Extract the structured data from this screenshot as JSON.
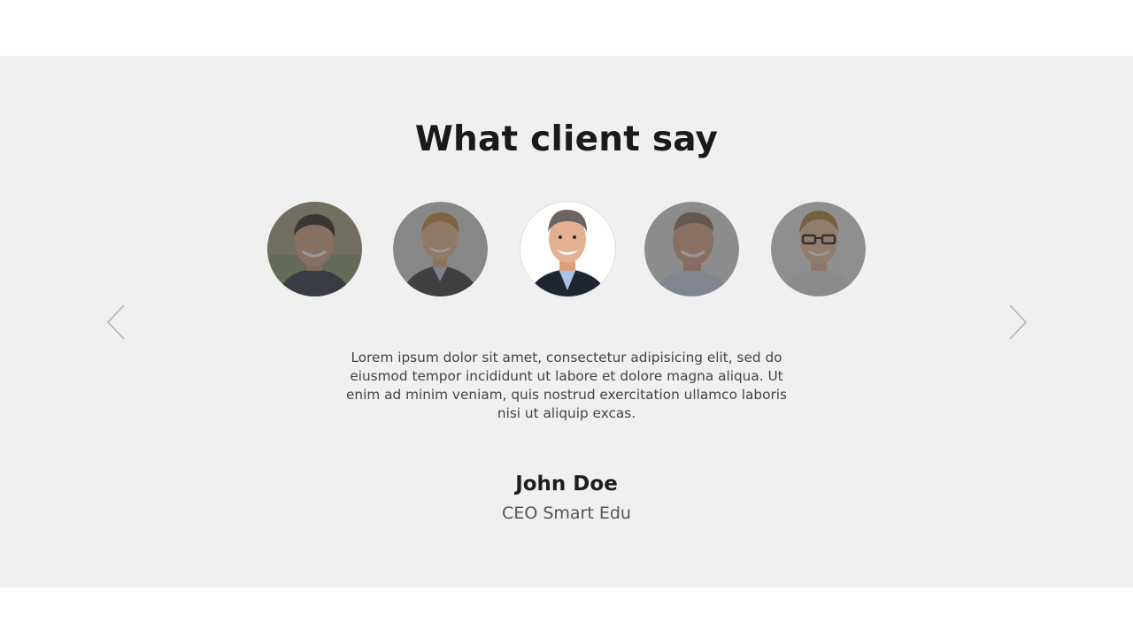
{
  "section": {
    "title": "What client say",
    "background": "#f0f0f0"
  },
  "carousel": {
    "prev_icon": "chevron-left-icon",
    "next_icon": "chevron-right-icon",
    "active_index": 2,
    "avatars": [
      {
        "name": "avatar-1",
        "active": false
      },
      {
        "name": "avatar-2",
        "active": false
      },
      {
        "name": "avatar-3",
        "active": true
      },
      {
        "name": "avatar-4",
        "active": false
      },
      {
        "name": "avatar-5",
        "active": false
      }
    ]
  },
  "testimonial": {
    "quote": "Lorem ipsum dolor sit amet, consectetur adipisicing elit, sed do eiusmod tempor incididunt ut labore et dolore magna aliqua. Ut enim ad minim veniam, quis nostrud exercitation ullamco laboris nisi ut aliquip excas.",
    "name": "John Doe",
    "role": "CEO Smart Edu"
  }
}
